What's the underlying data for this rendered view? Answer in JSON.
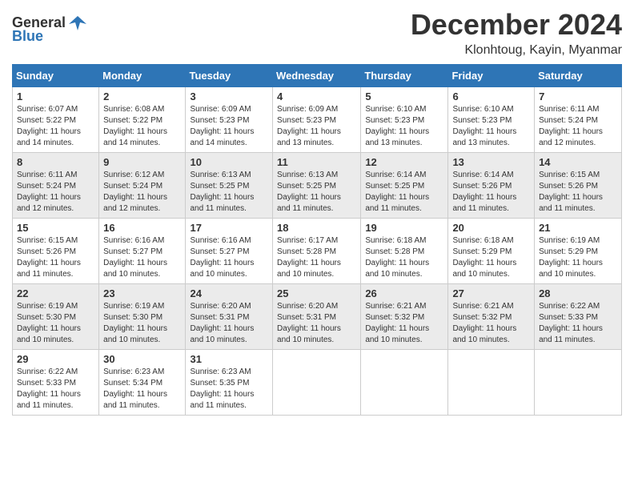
{
  "header": {
    "logo_general": "General",
    "logo_blue": "Blue",
    "month": "December 2024",
    "location": "Klonhtoug, Kayin, Myanmar"
  },
  "weekdays": [
    "Sunday",
    "Monday",
    "Tuesday",
    "Wednesday",
    "Thursday",
    "Friday",
    "Saturday"
  ],
  "weeks": [
    [
      {
        "day": "1",
        "sunrise": "6:07 AM",
        "sunset": "5:22 PM",
        "daylight": "11 hours and 14 minutes."
      },
      {
        "day": "2",
        "sunrise": "6:08 AM",
        "sunset": "5:22 PM",
        "daylight": "11 hours and 14 minutes."
      },
      {
        "day": "3",
        "sunrise": "6:09 AM",
        "sunset": "5:23 PM",
        "daylight": "11 hours and 14 minutes."
      },
      {
        "day": "4",
        "sunrise": "6:09 AM",
        "sunset": "5:23 PM",
        "daylight": "11 hours and 13 minutes."
      },
      {
        "day": "5",
        "sunrise": "6:10 AM",
        "sunset": "5:23 PM",
        "daylight": "11 hours and 13 minutes."
      },
      {
        "day": "6",
        "sunrise": "6:10 AM",
        "sunset": "5:23 PM",
        "daylight": "11 hours and 13 minutes."
      },
      {
        "day": "7",
        "sunrise": "6:11 AM",
        "sunset": "5:24 PM",
        "daylight": "11 hours and 12 minutes."
      }
    ],
    [
      {
        "day": "8",
        "sunrise": "6:11 AM",
        "sunset": "5:24 PM",
        "daylight": "11 hours and 12 minutes."
      },
      {
        "day": "9",
        "sunrise": "6:12 AM",
        "sunset": "5:24 PM",
        "daylight": "11 hours and 12 minutes."
      },
      {
        "day": "10",
        "sunrise": "6:13 AM",
        "sunset": "5:25 PM",
        "daylight": "11 hours and 11 minutes."
      },
      {
        "day": "11",
        "sunrise": "6:13 AM",
        "sunset": "5:25 PM",
        "daylight": "11 hours and 11 minutes."
      },
      {
        "day": "12",
        "sunrise": "6:14 AM",
        "sunset": "5:25 PM",
        "daylight": "11 hours and 11 minutes."
      },
      {
        "day": "13",
        "sunrise": "6:14 AM",
        "sunset": "5:26 PM",
        "daylight": "11 hours and 11 minutes."
      },
      {
        "day": "14",
        "sunrise": "6:15 AM",
        "sunset": "5:26 PM",
        "daylight": "11 hours and 11 minutes."
      }
    ],
    [
      {
        "day": "15",
        "sunrise": "6:15 AM",
        "sunset": "5:26 PM",
        "daylight": "11 hours and 11 minutes."
      },
      {
        "day": "16",
        "sunrise": "6:16 AM",
        "sunset": "5:27 PM",
        "daylight": "11 hours and 10 minutes."
      },
      {
        "day": "17",
        "sunrise": "6:16 AM",
        "sunset": "5:27 PM",
        "daylight": "11 hours and 10 minutes."
      },
      {
        "day": "18",
        "sunrise": "6:17 AM",
        "sunset": "5:28 PM",
        "daylight": "11 hours and 10 minutes."
      },
      {
        "day": "19",
        "sunrise": "6:18 AM",
        "sunset": "5:28 PM",
        "daylight": "11 hours and 10 minutes."
      },
      {
        "day": "20",
        "sunrise": "6:18 AM",
        "sunset": "5:29 PM",
        "daylight": "11 hours and 10 minutes."
      },
      {
        "day": "21",
        "sunrise": "6:19 AM",
        "sunset": "5:29 PM",
        "daylight": "11 hours and 10 minutes."
      }
    ],
    [
      {
        "day": "22",
        "sunrise": "6:19 AM",
        "sunset": "5:30 PM",
        "daylight": "11 hours and 10 minutes."
      },
      {
        "day": "23",
        "sunrise": "6:19 AM",
        "sunset": "5:30 PM",
        "daylight": "11 hours and 10 minutes."
      },
      {
        "day": "24",
        "sunrise": "6:20 AM",
        "sunset": "5:31 PM",
        "daylight": "11 hours and 10 minutes."
      },
      {
        "day": "25",
        "sunrise": "6:20 AM",
        "sunset": "5:31 PM",
        "daylight": "11 hours and 10 minutes."
      },
      {
        "day": "26",
        "sunrise": "6:21 AM",
        "sunset": "5:32 PM",
        "daylight": "11 hours and 10 minutes."
      },
      {
        "day": "27",
        "sunrise": "6:21 AM",
        "sunset": "5:32 PM",
        "daylight": "11 hours and 10 minutes."
      },
      {
        "day": "28",
        "sunrise": "6:22 AM",
        "sunset": "5:33 PM",
        "daylight": "11 hours and 11 minutes."
      }
    ],
    [
      {
        "day": "29",
        "sunrise": "6:22 AM",
        "sunset": "5:33 PM",
        "daylight": "11 hours and 11 minutes."
      },
      {
        "day": "30",
        "sunrise": "6:23 AM",
        "sunset": "5:34 PM",
        "daylight": "11 hours and 11 minutes."
      },
      {
        "day": "31",
        "sunrise": "6:23 AM",
        "sunset": "5:35 PM",
        "daylight": "11 hours and 11 minutes."
      },
      null,
      null,
      null,
      null
    ]
  ],
  "labels": {
    "sunrise": "Sunrise:",
    "sunset": "Sunset:",
    "daylight": "Daylight:"
  }
}
